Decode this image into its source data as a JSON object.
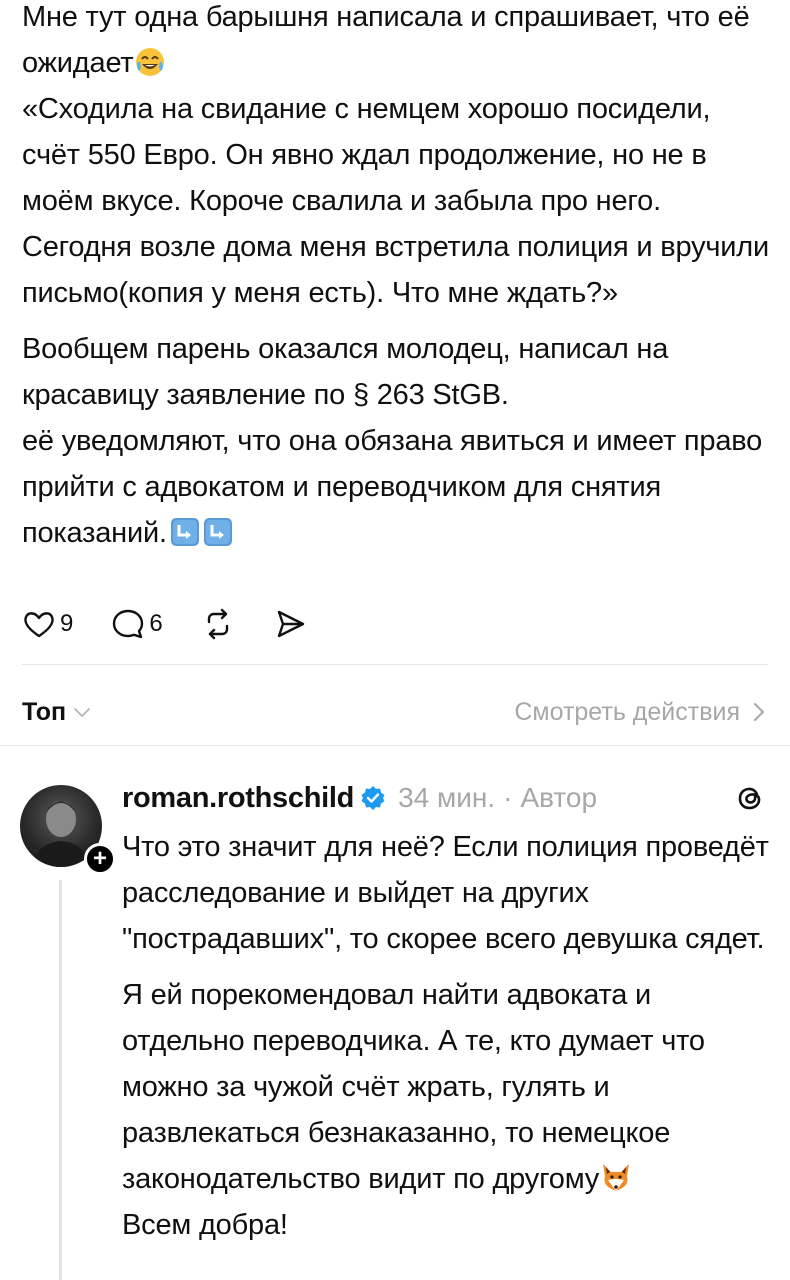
{
  "post": {
    "paragraph1": "Мне тут одна барышня написала и спрашивает, что её ожидает",
    "paragraph2": "«Сходила на свидание с немцем хорошо посидели, счёт 550 Евро. Он явно ждал продолжение, но не в моём вкусе. Короче свалила и забыла про него. Сегодня возле дома меня встретила полиция и вручили письмо(копия у меня есть). Что мне ждать?»",
    "paragraph3": "Вообщем парень оказался молодец, написал на красавицу заявление по § 263 StGB.",
    "paragraph4": "её уведомляют, что она обязана явиться и имеет право прийти с адвокатом и переводчиком для снятия показаний.",
    "emoji_after_p1": "rolling-on-floor-laughing",
    "emoji_after_p4": [
      "arrow-down-right",
      "arrow-down-right"
    ]
  },
  "actions": {
    "likes": "9",
    "comments": "6"
  },
  "sort": {
    "label": "Топ",
    "view_activity": "Смотреть действия"
  },
  "reply": {
    "username": "roman.rothschild",
    "time": "34 мин.",
    "separator": "·",
    "role": "Автор",
    "paragraph1": "Что это значит для неё? Если полиция проведёт расследование и выйдет на других \"пострадавших\", то скорее всего девушка сядет.",
    "paragraph2": "Я ей порекомендовал найти адвоката и отдельно переводчика. А те, кто думает что можно за чужой счёт жрать, гулять и развлекаться безнаказанно, то немецкое законодательство видит по другому",
    "paragraph3": "Всем добра!",
    "emoji_after_p2": "fox"
  },
  "colors": {
    "text": "#101010",
    "muted": "#a7a7a7",
    "verified": "#1d9bf0",
    "divider": "#e6e6e6"
  }
}
